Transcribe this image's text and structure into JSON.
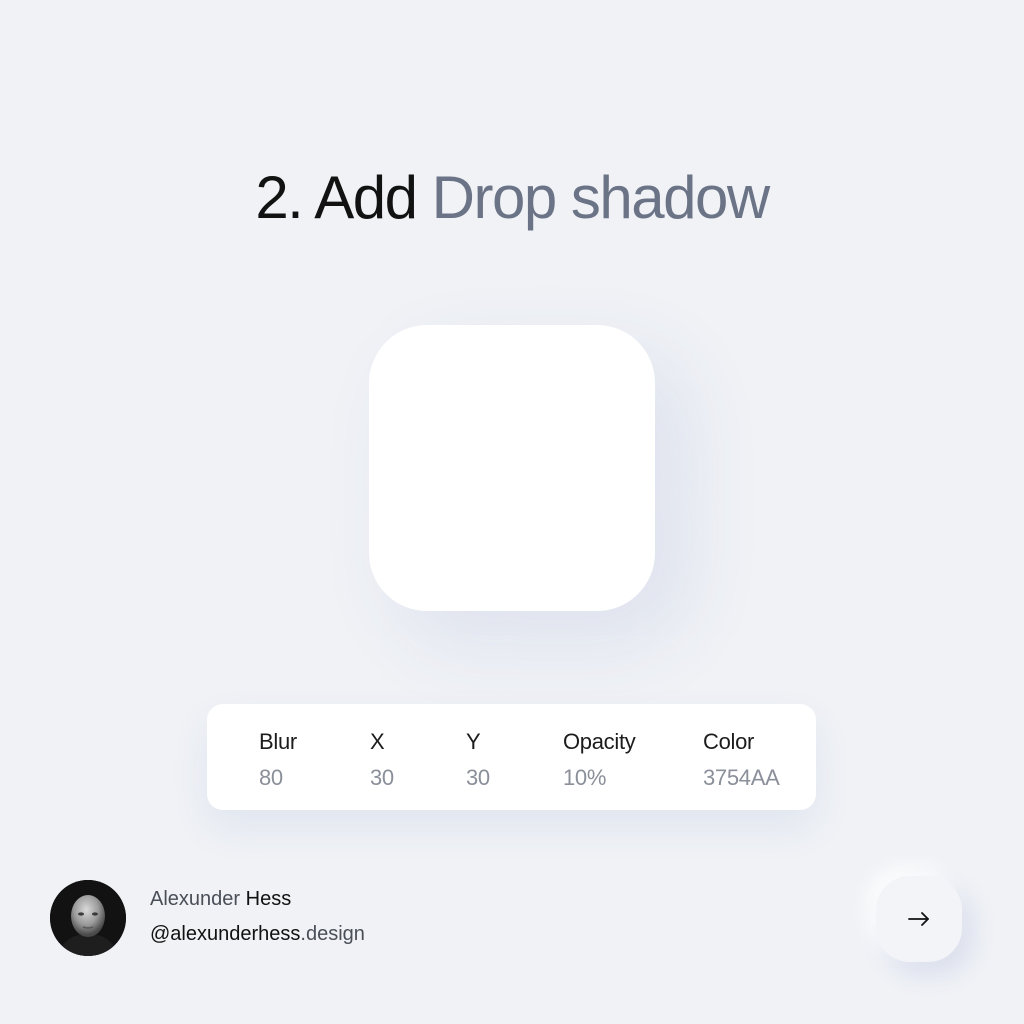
{
  "title": {
    "prefix": "2. Add",
    "highlight": "Drop shadow"
  },
  "shadow_params": [
    {
      "label": "Blur",
      "value": "80"
    },
    {
      "label": "X",
      "value": "30"
    },
    {
      "label": "Y",
      "value": "30"
    },
    {
      "label": "Opacity",
      "value": "10%"
    },
    {
      "label": "Color",
      "value": "3754AA"
    }
  ],
  "author": {
    "first_name": "Alexunder",
    "last_name": "Hess",
    "handle": "@alexunderhess",
    "handle_suffix": ".design"
  },
  "icons": {
    "next": "arrow-right-icon",
    "avatar": "author-photo"
  },
  "colors": {
    "background": "#f0f2f6",
    "title_dark": "#121212",
    "title_accent": "#6b7386",
    "card": "#ffffff",
    "shadow_color": "#3754AA"
  }
}
